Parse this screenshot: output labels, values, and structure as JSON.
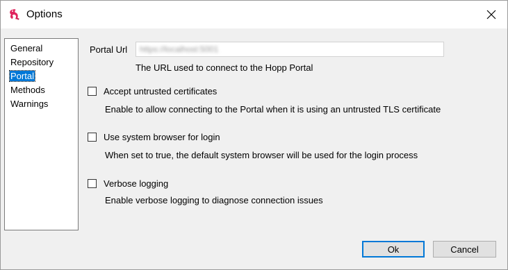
{
  "window": {
    "title": "Options"
  },
  "nav": {
    "items": [
      {
        "label": "General",
        "selected": false
      },
      {
        "label": "Repository",
        "selected": false
      },
      {
        "label": "Portal",
        "selected": true
      },
      {
        "label": "Methods",
        "selected": false
      },
      {
        "label": "Warnings",
        "selected": false
      }
    ]
  },
  "portal": {
    "url_label": "Portal Url",
    "url_value": "https://localhost:5001",
    "url_help": "The URL used to connect to the Hopp Portal",
    "options": [
      {
        "label": "Accept untrusted certificates",
        "checked": false,
        "description": "Enable to allow connecting to the Portal when it is using an untrusted TLS certificate"
      },
      {
        "label": "Use system browser for login",
        "checked": false,
        "description": "When set to true, the default system browser will be used for the login process"
      },
      {
        "label": "Verbose logging",
        "checked": false,
        "description": "Enable verbose logging to diagnose connection issues"
      }
    ]
  },
  "buttons": {
    "ok": "Ok",
    "cancel": "Cancel"
  },
  "colors": {
    "accent": "#0078d7",
    "icon": "#e0245e"
  }
}
